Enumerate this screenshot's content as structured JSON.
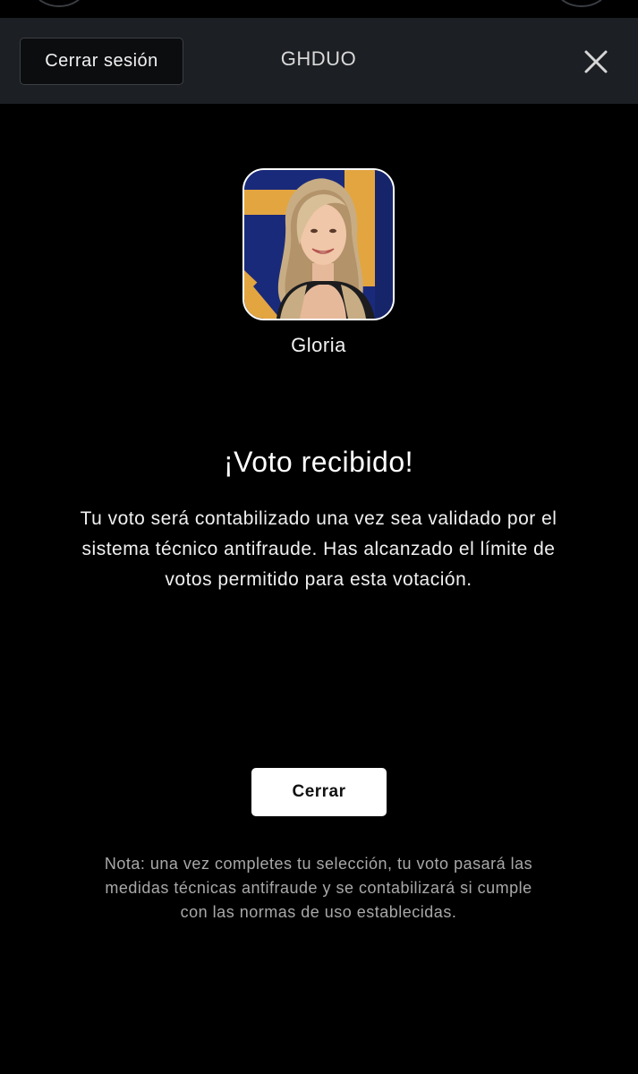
{
  "header": {
    "logout_label": "Cerrar sesión",
    "title": "GHDUO",
    "close_icon": "close-icon"
  },
  "contestant": {
    "name": "Gloria",
    "photo_icon": "contestant-photo"
  },
  "confirmation": {
    "title": "¡Voto recibido!",
    "message": "Tu voto será contabilizado una vez sea validado por el sistema técnico antifraude. Has alcanzado el límite de votos permitido para esta votación.",
    "button_label": "Cerrar",
    "note": "Nota: una vez completes tu selección, tu voto pasará las medidas técnicas antifraude y se contabilizará si cumple con las normas de uso establecidas."
  },
  "colors": {
    "background": "#000000",
    "header_bg": "#1c1f23",
    "button_bg": "#ffffff",
    "avatar_blue": "#1a2a7a",
    "avatar_gold": "#e3a540"
  }
}
